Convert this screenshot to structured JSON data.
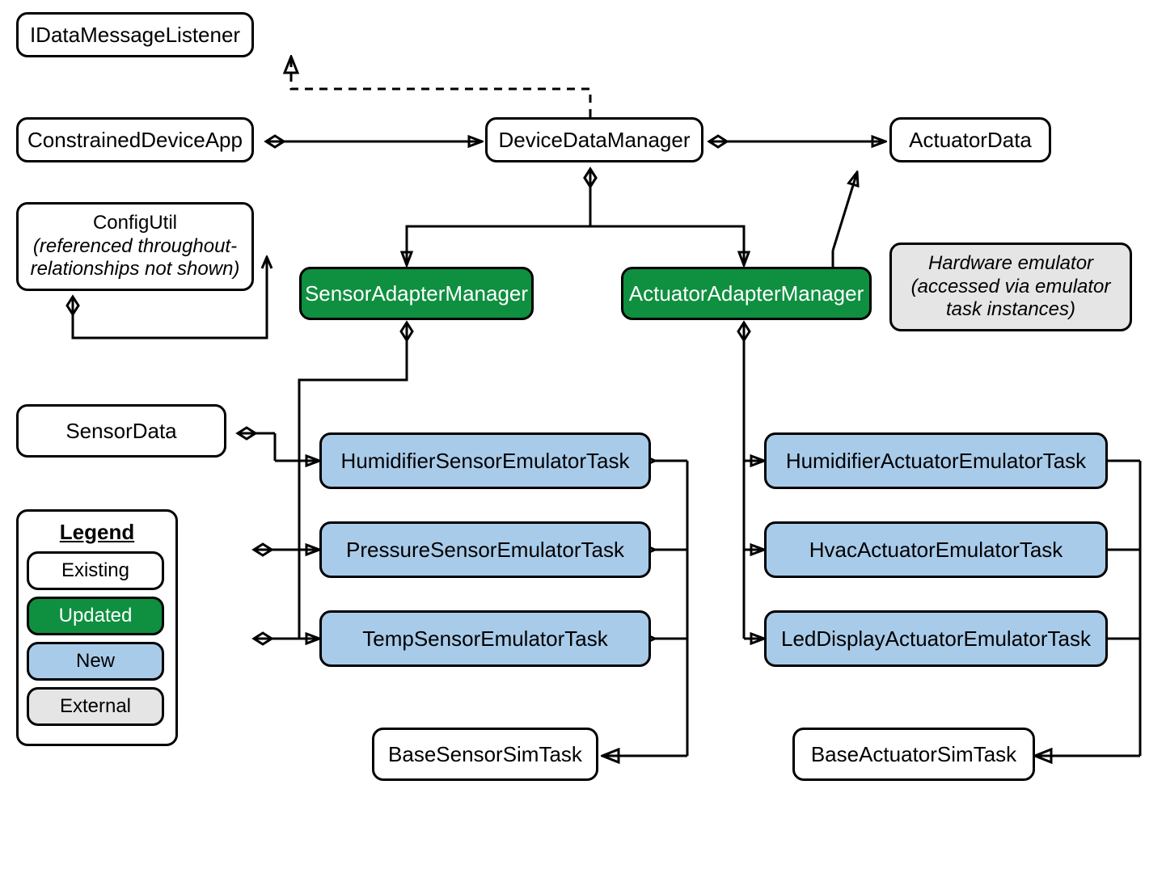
{
  "nodes": {
    "idml": "IDataMessageListener",
    "cda": "ConstrainedDeviceApp",
    "cfg_l1": "ConfigUtil",
    "cfg_l2": "(referenced throughout-",
    "cfg_l3": "relationships not shown)",
    "ddm": "DeviceDataManager",
    "sam": "SensorAdapterManager",
    "aam": "ActuatorAdapterManager",
    "ad": "ActuatorData",
    "hwemu_l1": "Hardware emulator",
    "hwemu_l2": "(accessed via emulator",
    "hwemu_l3": "task instances)",
    "sd": "SensorData",
    "hsensor": "HumidifierSensorEmulatorTask",
    "psensor": "PressureSensorEmulatorTask",
    "tsensor": "TempSensorEmulatorTask",
    "bsst": "BaseSensorSimTask",
    "hact": "HumidifierActuatorEmulatorTask",
    "hvac": "HvacActuatorEmulatorTask",
    "ledact": "LedDisplayActuatorEmulatorTask",
    "bast": "BaseActuatorSimTask"
  },
  "legend": {
    "title": "Legend",
    "existing": "Existing",
    "updated": "Updated",
    "new": "New",
    "external": "External"
  },
  "colors": {
    "updated": "#0f8f40",
    "new": "#a8cbe9",
    "external": "#e5e5e5"
  }
}
